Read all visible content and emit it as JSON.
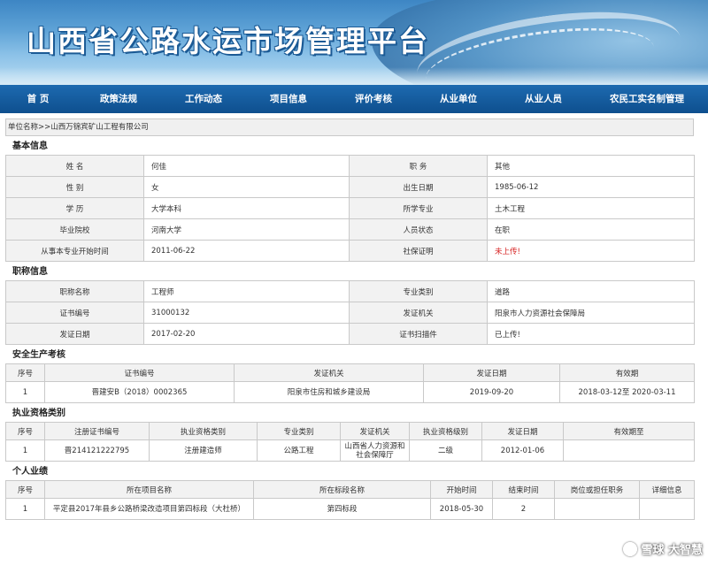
{
  "header": {
    "site_title": "山西省公路水运市场管理平台"
  },
  "nav": {
    "items": [
      "首  页",
      "政策法规",
      "工作动态",
      "项目信息",
      "评价考核",
      "从业单位",
      "从业人员",
      "农民工实名制管理"
    ]
  },
  "breadcrumb": "单位名称>>山西万锦宾矿山工程有限公司",
  "basic": {
    "title": "基本信息",
    "rows": [
      [
        {
          "k": "姓      名",
          "v": "何佳"
        },
        {
          "k": "职      务",
          "v": "其他"
        }
      ],
      [
        {
          "k": "性      别",
          "v": "女"
        },
        {
          "k": "出生日期",
          "v": "1985-06-12"
        }
      ],
      [
        {
          "k": "学      历",
          "v": "大学本科"
        },
        {
          "k": "所学专业",
          "v": "土木工程"
        }
      ],
      [
        {
          "k": "毕业院校",
          "v": "河南大学"
        },
        {
          "k": "人员状态",
          "v": "在职"
        }
      ],
      [
        {
          "k": "从事本专业开始时间",
          "v": "2011-06-22"
        },
        {
          "k": "社保证明",
          "v": "未上传!"
        }
      ]
    ]
  },
  "title_info": {
    "title": "职称信息",
    "rows": [
      [
        {
          "k": "职称名称",
          "v": "工程师"
        },
        {
          "k": "专业类别",
          "v": "道路"
        }
      ],
      [
        {
          "k": "证书编号",
          "v": "31000132"
        },
        {
          "k": "发证机关",
          "v": "阳泉市人力资源社会保障局"
        }
      ],
      [
        {
          "k": "发证日期",
          "v": "2017-02-20"
        },
        {
          "k": "证书扫描件",
          "v": "已上传!"
        }
      ]
    ]
  },
  "safety": {
    "title": "安全生产考核",
    "headers": [
      "序号",
      "证书编号",
      "发证机关",
      "发证日期",
      "有效期"
    ],
    "rows": [
      [
        "1",
        "晋建安B（2018）0002365",
        "阳泉市住房和城乡建设局",
        "2019-09-20",
        "2018-03-12至 2020-03-11"
      ]
    ]
  },
  "qualification": {
    "title": "执业资格类别",
    "headers": [
      "序号",
      "注册证书编号",
      "执业资格类别",
      "专业类别",
      "发证机关",
      "执业资格级别",
      "发证日期",
      "有效期至"
    ],
    "rows": [
      [
        "1",
        "晋214121222795",
        "注册建造师",
        "公路工程",
        "山西省人力资源和社会保障厅",
        "二级",
        "2012-01-06",
        ""
      ]
    ]
  },
  "performance": {
    "title": "个人业绩",
    "headers": [
      "序号",
      "所在项目名称",
      "所在标段名称",
      "开始时间",
      "结束时间",
      "岗位或担任职务",
      "详细信息"
    ],
    "rows": [
      [
        "1",
        "平定县2017年县乡公路桥梁改造项目第四标段（大杜桥）",
        "第四标段",
        "2018-05-30",
        "2",
        "",
        ""
      ]
    ]
  },
  "watermark": "雪球 大智慧"
}
